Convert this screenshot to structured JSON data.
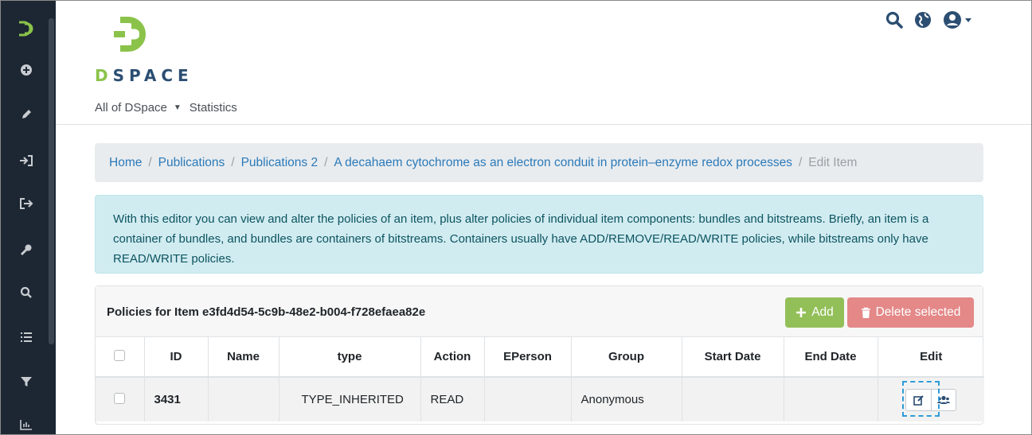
{
  "brand": {
    "name_first": "D",
    "name_rest": "SPACE"
  },
  "colors": {
    "sidebar": "#1d2733",
    "accent_green": "#8bc34a",
    "brand_blue": "#2b4e72",
    "link": "#2b7ab8",
    "info_bg": "#d1ecf1",
    "add": "#92bf58",
    "delete": "#e48888",
    "highlight": "#2e9bd8"
  },
  "sidebar": {
    "items": [
      {
        "icon": "dspace-logo-icon"
      },
      {
        "icon": "plus-circle-icon"
      },
      {
        "icon": "pencil-icon"
      },
      {
        "icon": "import-icon"
      },
      {
        "icon": "export-icon"
      },
      {
        "icon": "key-icon"
      },
      {
        "icon": "search-icon"
      },
      {
        "icon": "list-icon"
      },
      {
        "icon": "filter-icon"
      },
      {
        "icon": "chart-icon"
      }
    ]
  },
  "header": {
    "icons": [
      "search-icon",
      "globe-icon",
      "user-icon"
    ],
    "nav": [
      {
        "label": "All of DSpace"
      },
      {
        "label": "Statistics"
      }
    ]
  },
  "breadcrumb": {
    "items": [
      "Home",
      "Publications",
      "Publications 2",
      "A decahaem cytochrome as an electron conduit in protein–enzyme redox processes"
    ],
    "current": "Edit Item"
  },
  "info": {
    "text": "With this editor you can view and alter the policies of an item, plus alter policies of individual item components: bundles and bitstreams. Briefly, an item is a container of bundles, and bundles are containers of bitstreams. Containers usually have ADD/REMOVE/READ/WRITE policies, while bitstreams only have READ/WRITE policies."
  },
  "policies": {
    "title": "Policies for Item e3fd4d54-5c9b-48e2-b004-f728efaea82e",
    "add_label": "Add",
    "delete_label": "Delete selected",
    "columns": [
      "ID",
      "Name",
      "type",
      "Action",
      "EPerson",
      "Group",
      "Start Date",
      "End Date",
      "Edit"
    ],
    "rows": [
      {
        "id": "3431",
        "name": "",
        "type": "TYPE_INHERITED",
        "action": "READ",
        "eperson": "",
        "group": "Anonymous",
        "start_date": "",
        "end_date": ""
      }
    ]
  }
}
